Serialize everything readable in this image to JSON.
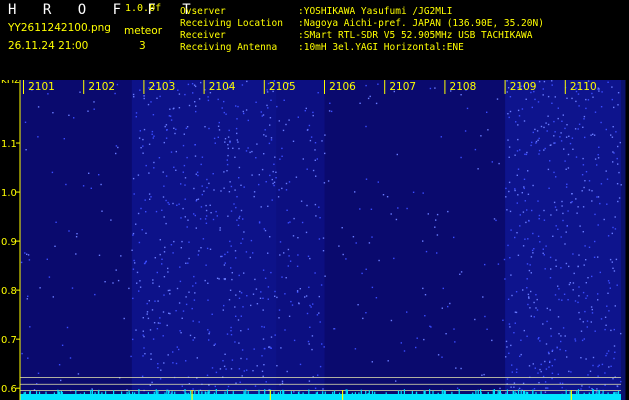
{
  "header": {
    "title": "H R O F F T",
    "version": "1.0.0f",
    "filename": "YY2611242100.png",
    "meteor_label": "meteor",
    "datetime": "26.11.24 21:00",
    "meteor_count": "3",
    "info": [
      {
        "key": "Ovserver",
        "value": ":YOSHIKAWA Yasufumi /JG2MLI"
      },
      {
        "key": "Receiving Location",
        "value": ":Nagoya Aichi-pref. JAPAN (136.90E, 35.20N)"
      },
      {
        "key": "Receiver",
        "value": ":SMart RTL-SDR V5 52.905MHz USB TACHIKAWA"
      },
      {
        "key": "Receiving Antenna",
        "value": ":10mH 3el.YAGI Horizontal:ENE"
      }
    ]
  },
  "colors": {
    "background": "#000000",
    "label": "#ffff00",
    "noise_base": "#0a0a6e",
    "noise_bright": "#3a4cff",
    "baseline": "#00e5ff",
    "hline": "#e8e8b0"
  },
  "chart_data": {
    "type": "heatmap",
    "yunit": "kHz",
    "ylim": [
      0.58,
      1.2
    ],
    "yticks": [
      "0.6",
      "0.7",
      "0.8",
      "0.9",
      "1.0",
      "1.1"
    ],
    "yticks_values": [
      0.6,
      0.7,
      0.8,
      0.9,
      1.0,
      1.1
    ],
    "xlabels": [
      "2101",
      "2102",
      "2103",
      "2104",
      "2105",
      "2106",
      "2107",
      "2108",
      "2109",
      "2110"
    ],
    "bright_segments": [
      {
        "from_min": 1.8,
        "to_min": 4.2,
        "intensity": 0.9
      },
      {
        "from_min": 4.2,
        "to_min": 5.0,
        "intensity": 0.6
      },
      {
        "from_min": 8.0,
        "to_min": 10.0,
        "intensity": 1.0
      }
    ],
    "hlines_khz": [
      0.622,
      0.608,
      0.595
    ],
    "meteor_ticks_min": [
      2.8,
      4.1,
      5.3,
      9.1
    ]
  }
}
